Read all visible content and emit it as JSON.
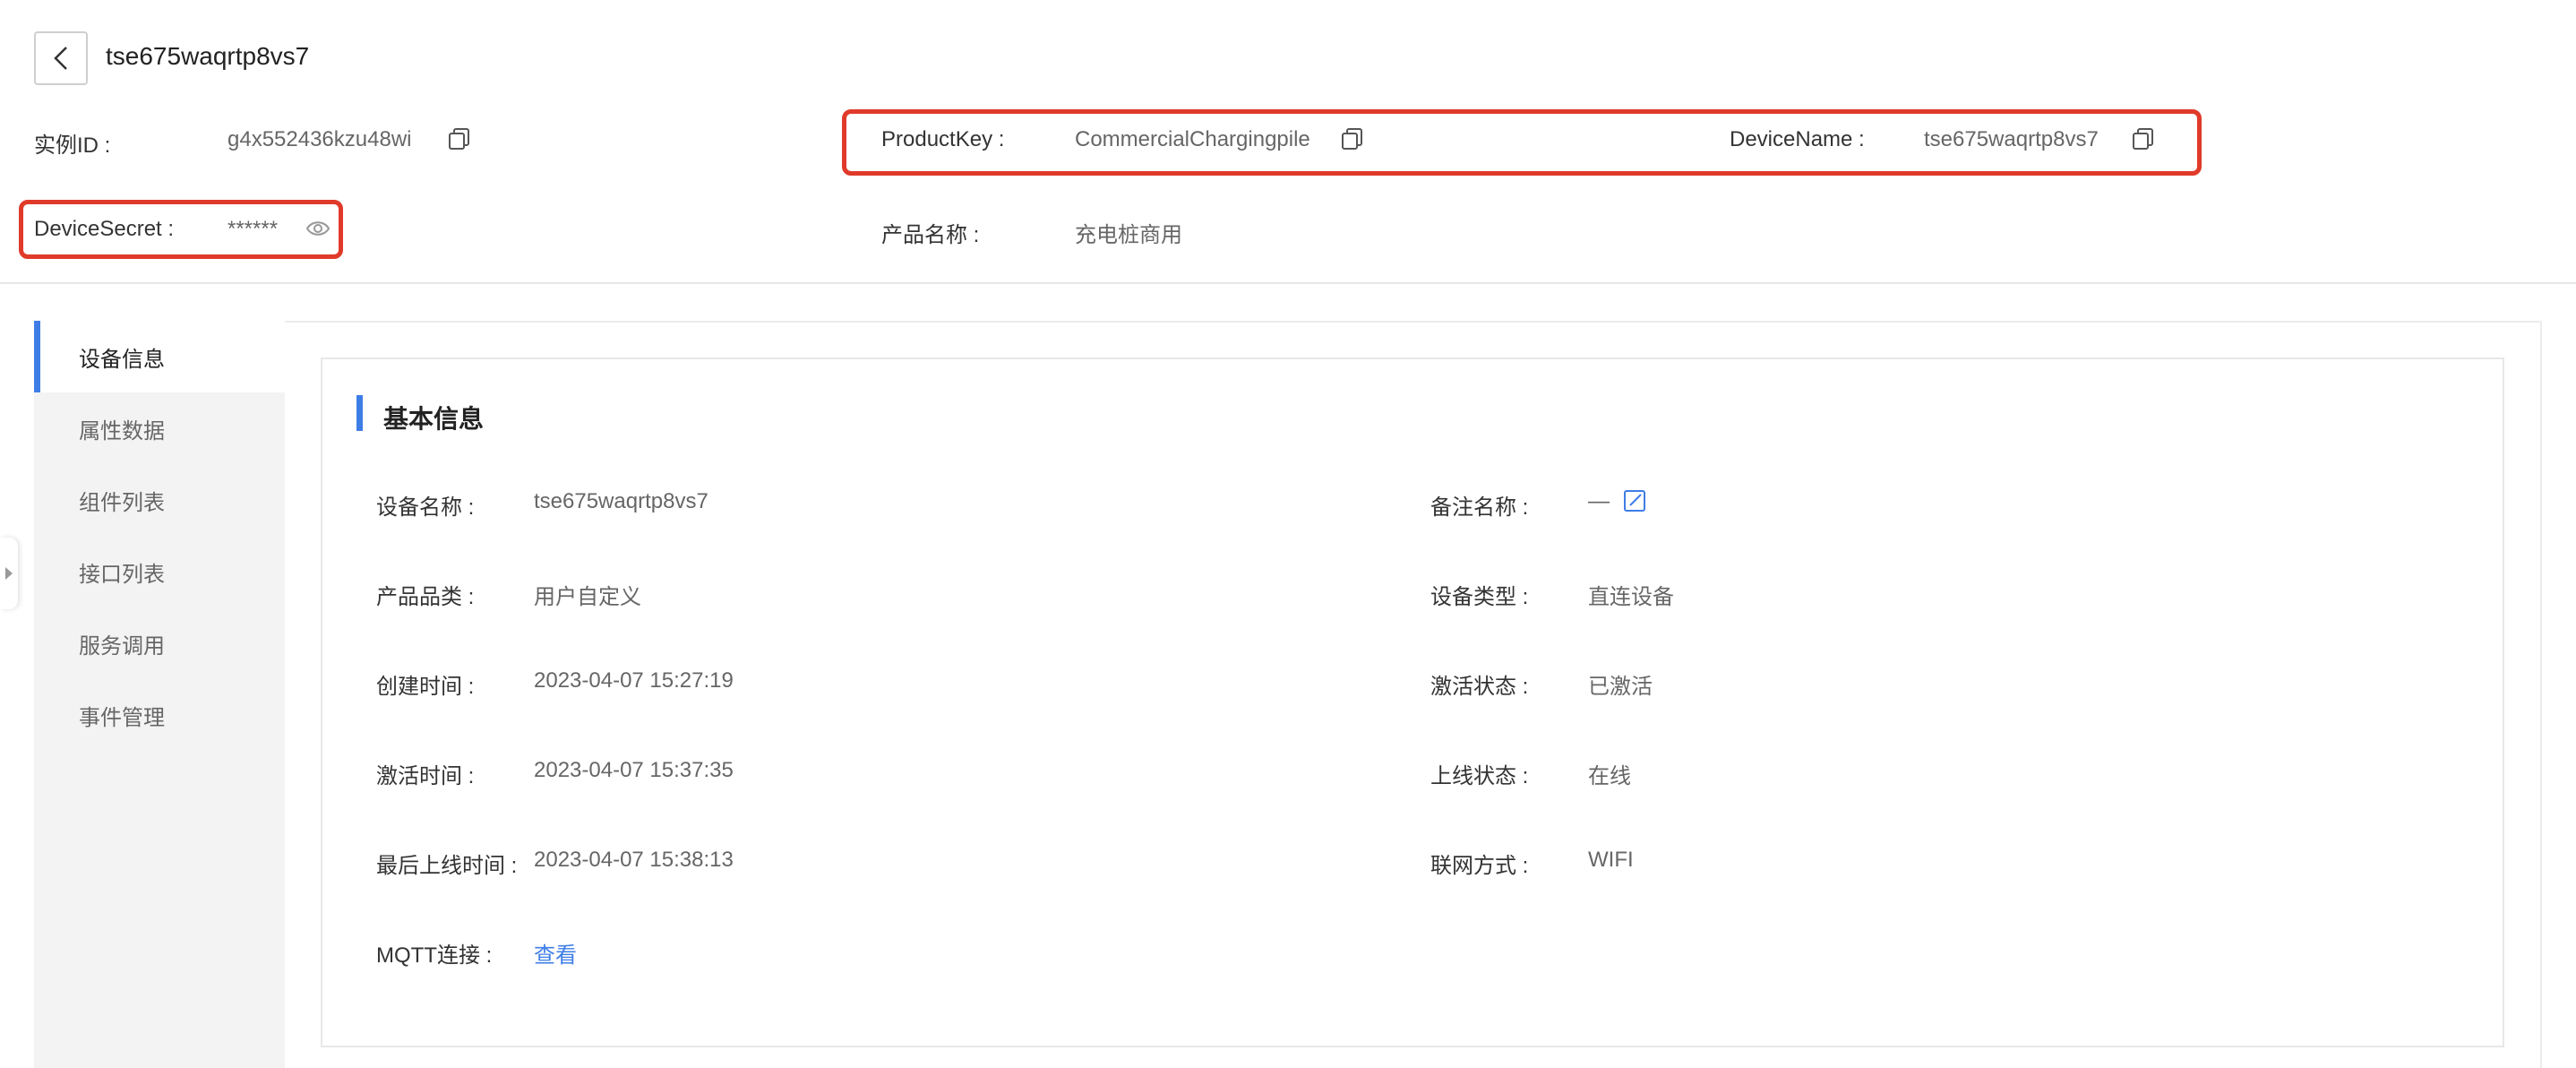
{
  "header": {
    "title": "tse675waqrtp8vs7"
  },
  "instance": {
    "id_label": "实例ID :",
    "id_value": "g4x552436kzu48wi"
  },
  "product_key": {
    "label": "ProductKey :",
    "value": "CommercialChargingpile"
  },
  "device_name": {
    "label": "DeviceName :",
    "value": "tse675waqrtp8vs7"
  },
  "device_secret": {
    "label": "DeviceSecret :",
    "value": "******"
  },
  "product_name": {
    "label": "产品名称 :",
    "value": "充电桩商用"
  },
  "sidebar": {
    "items": [
      {
        "label": "设备信息"
      },
      {
        "label": "属性数据"
      },
      {
        "label": "组件列表"
      },
      {
        "label": "接口列表"
      },
      {
        "label": "服务调用"
      },
      {
        "label": "事件管理"
      }
    ]
  },
  "basic_info": {
    "title": "基本信息",
    "left": [
      {
        "label": "设备名称 :",
        "value": "tse675waqrtp8vs7"
      },
      {
        "label": "产品品类 :",
        "value": "用户自定义"
      },
      {
        "label": "创建时间 :",
        "value": "2023-04-07 15:27:19"
      },
      {
        "label": "激活时间 :",
        "value": "2023-04-07 15:37:35"
      },
      {
        "label": "最后上线时间 :",
        "value": "2023-04-07 15:38:13"
      },
      {
        "label": "MQTT连接 :",
        "value": "查看"
      }
    ],
    "right": [
      {
        "label": "备注名称 :",
        "value": "—"
      },
      {
        "label": "设备类型 :",
        "value": "直连设备"
      },
      {
        "label": "激活状态 :",
        "value": "已激活"
      },
      {
        "label": "上线状态 :",
        "value": "在线"
      },
      {
        "label": "联网方式 :",
        "value": "WIFI"
      }
    ]
  },
  "icons": {
    "back": "chevron-left-icon",
    "copy": "copy-icon",
    "eye": "eye-icon",
    "edit": "edit-icon"
  },
  "colors": {
    "accent": "#3e7de6",
    "highlight": "#e03a2a"
  }
}
